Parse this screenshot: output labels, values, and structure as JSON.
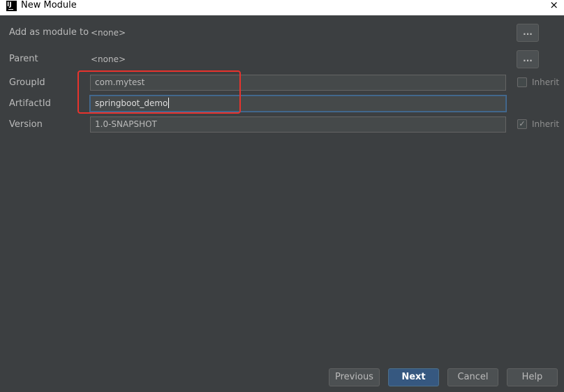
{
  "window": {
    "title": "New Module",
    "close_glyph": "×"
  },
  "form": {
    "add_as_module_label": "Add as module to",
    "add_as_module_value": "<none>",
    "parent_label": "Parent",
    "parent_value": "<none>",
    "groupid_label": "GroupId",
    "groupid_value": "com.mytest",
    "artifactid_label": "ArtifactId",
    "artifactid_value": "springboot_demo",
    "version_label": "Version",
    "version_value": "1.0-SNAPSHOT",
    "browse_label": "...",
    "inherit_label": "Inherit",
    "groupid_inherit_checked": false,
    "version_inherit_checked": true
  },
  "buttons": {
    "previous": "Previous",
    "next": "Next",
    "cancel": "Cancel",
    "help": "Help"
  },
  "colors": {
    "background": "#3c3f41",
    "field_bg": "#45494a",
    "primary_button": "#365880",
    "highlight_annotation": "#e8332d"
  }
}
